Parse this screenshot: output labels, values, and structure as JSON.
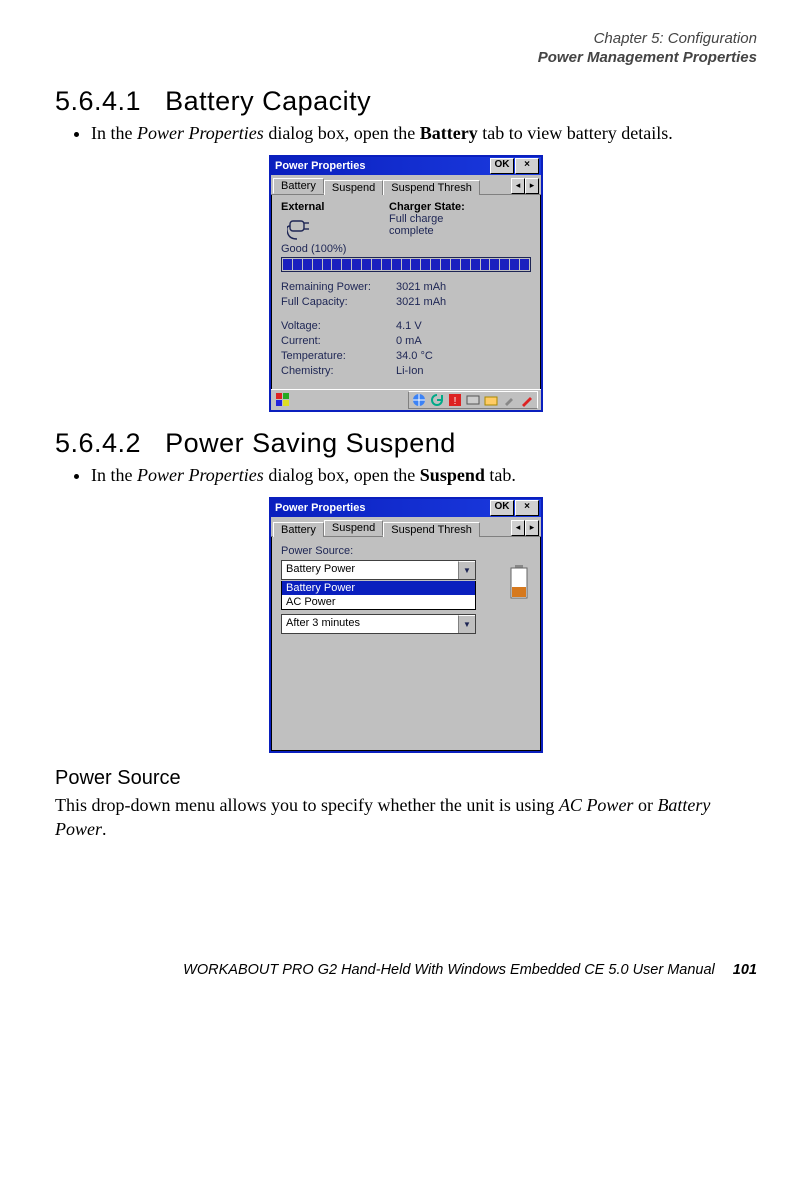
{
  "header": {
    "line1": "Chapter 5: Configuration",
    "line2": "Power Management Properties"
  },
  "s1": {
    "num": "5.6.4.1",
    "title": "Battery Capacity",
    "bullet_pre": "In the ",
    "bullet_em": "Power Properties",
    "bullet_mid": " dialog box, open the ",
    "bullet_bold": "Battery",
    "bullet_post": " tab to view battery details."
  },
  "dlg1": {
    "title": "Power Properties",
    "ok": "OK",
    "close": "×",
    "tabs": {
      "battery": "Battery",
      "suspend": "Suspend",
      "thresh": "Suspend Thresh"
    },
    "spin_left": "◂",
    "spin_right": "▸",
    "external": "External",
    "charger_head": "Charger State:",
    "charger_val1": "Full charge",
    "charger_val2": "complete",
    "good": "Good  (100%)",
    "stats": {
      "remaining_k": "Remaining Power:",
      "remaining_v": "3021 mAh",
      "fullcap_k": "Full Capacity:",
      "fullcap_v": "3021 mAh",
      "voltage_k": "Voltage:",
      "voltage_v": "4.1 V",
      "current_k": "Current:",
      "current_v": "0 mA",
      "temp_k": "Temperature:",
      "temp_v": "34.0 °C",
      "chem_k": "Chemistry:",
      "chem_v": "Li-Ion"
    }
  },
  "s2": {
    "num": "5.6.4.2",
    "title": "Power Saving Suspend",
    "bullet_pre": "In the ",
    "bullet_em": "Power Properties",
    "bullet_mid": " dialog box, open the ",
    "bullet_bold": "Suspend",
    "bullet_post": " tab."
  },
  "dlg2": {
    "title": "Power Properties",
    "ok": "OK",
    "close": "×",
    "tabs": {
      "battery": "Battery",
      "suspend": "Suspend",
      "thresh": "Suspend Thresh"
    },
    "spin_left": "◂",
    "spin_right": "▸",
    "ps_label": "Power Source:",
    "combo_sel": "Battery Power",
    "combo_opt1": "Battery Power",
    "combo_opt2": "AC Power",
    "combo2_sel": "After 3 minutes"
  },
  "subhead": "Power Source",
  "body": {
    "pre": "This drop-down menu allows you to specify whether the unit is using ",
    "em1": "AC Power",
    "mid": " or ",
    "em2": "Battery Power",
    "post": "."
  },
  "footer": {
    "text": "WORKABOUT PRO G2 Hand-Held With Windows Embedded CE 5.0 User Manual",
    "page": "101"
  }
}
